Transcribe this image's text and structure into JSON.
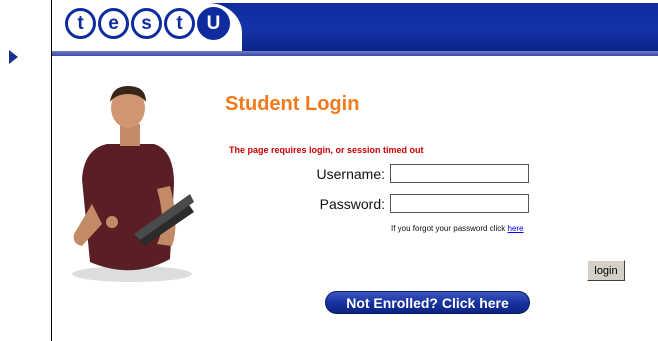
{
  "logo": {
    "letters": [
      "t",
      "e",
      "s",
      "t",
      "U"
    ]
  },
  "page": {
    "title": "Student Login",
    "error": "The page requires login, or session timed out"
  },
  "form": {
    "username_label": "Username:",
    "password_label": "Password:",
    "username_value": "",
    "password_value": "",
    "forgot_text": "If you forgot your password click",
    "forgot_link": "here",
    "login_button": "login"
  },
  "enroll_button": "Not Enrolled? Click here",
  "colors": {
    "brand_blue": "#0f2c9e",
    "title_orange": "#f27a1a",
    "error_red": "#cc0000"
  }
}
